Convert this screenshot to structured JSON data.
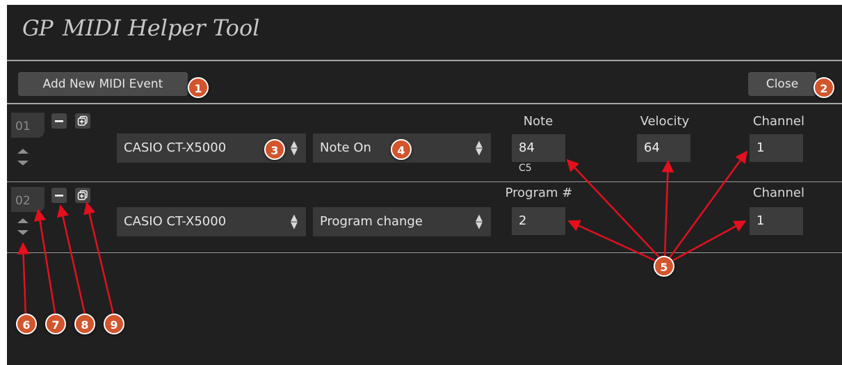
{
  "app": {
    "title": "MIDI Helper Tool",
    "logo": "GP"
  },
  "toolbar": {
    "add_label": "Add New MIDI Event",
    "close_label": "Close"
  },
  "events": [
    {
      "number": "01",
      "device": "CASIO CT-X5000",
      "type": "Note On",
      "params": {
        "note_label": "Note",
        "note_value": "84",
        "note_name": "C5",
        "velocity_label": "Velocity",
        "velocity_value": "64",
        "channel_label": "Channel",
        "channel_value": "1"
      }
    },
    {
      "number": "02",
      "device": "CASIO CT-X5000",
      "type": "Program change",
      "params": {
        "program_label": "Program #",
        "program_value": "2",
        "channel_label": "Channel",
        "channel_value": "1"
      }
    }
  ],
  "icons": {
    "remove": "minus-icon",
    "duplicate": "duplicate-icon",
    "move": "up-down-arrows-icon",
    "select": "select-caret-icon"
  },
  "callouts": [
    "1",
    "2",
    "3",
    "4",
    "5",
    "6",
    "7",
    "8",
    "9"
  ],
  "colors": {
    "background": "#202020",
    "badge": "#d2552d",
    "arrow": "#e3101e",
    "field": "#3c3c3c"
  }
}
